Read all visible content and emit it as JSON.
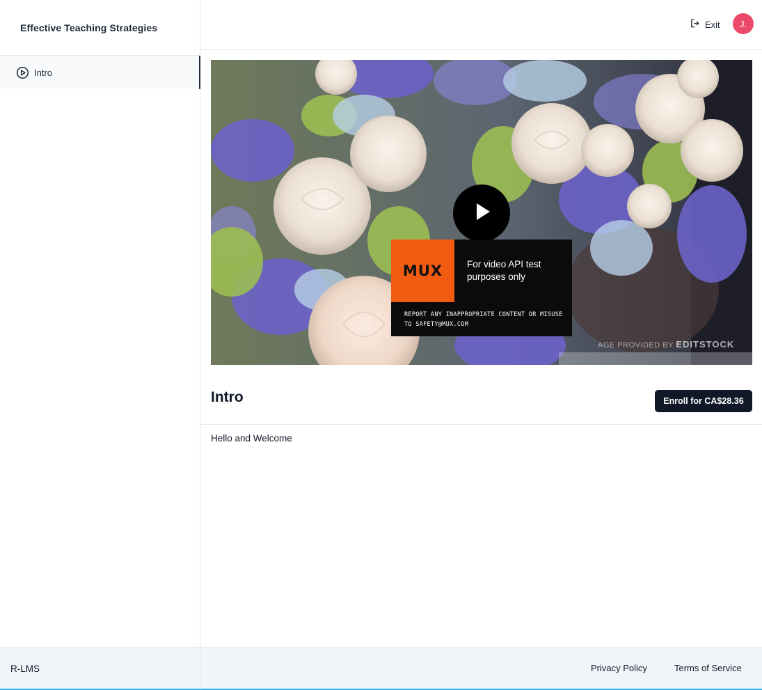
{
  "sidebar": {
    "course_title": "Effective Teaching Strategies",
    "lessons": [
      {
        "label": "Intro",
        "icon": "play-circle-icon",
        "active": true
      }
    ]
  },
  "topbar": {
    "exit_label": "Exit",
    "avatar_initial": "J.",
    "avatar_color": "#ec4868"
  },
  "video": {
    "watermark_brand": "MUX",
    "watermark_text": "For video API test purposes only",
    "watermark_report": "REPORT ANY INAPPROPRIATE CONTENT OR MISUSE TO SAFETY@MUX.COM",
    "credit_prefix": "AGE PROVIDED BY",
    "credit_brand": "EDITSTOCK",
    "accent": "#f25b12"
  },
  "lesson": {
    "title": "Intro",
    "enroll_label": "Enroll for CA$28.36",
    "body": "Hello and Welcome"
  },
  "footer": {
    "brand": "R-LMS",
    "links": [
      "Privacy Policy",
      "Terms of Service"
    ]
  }
}
